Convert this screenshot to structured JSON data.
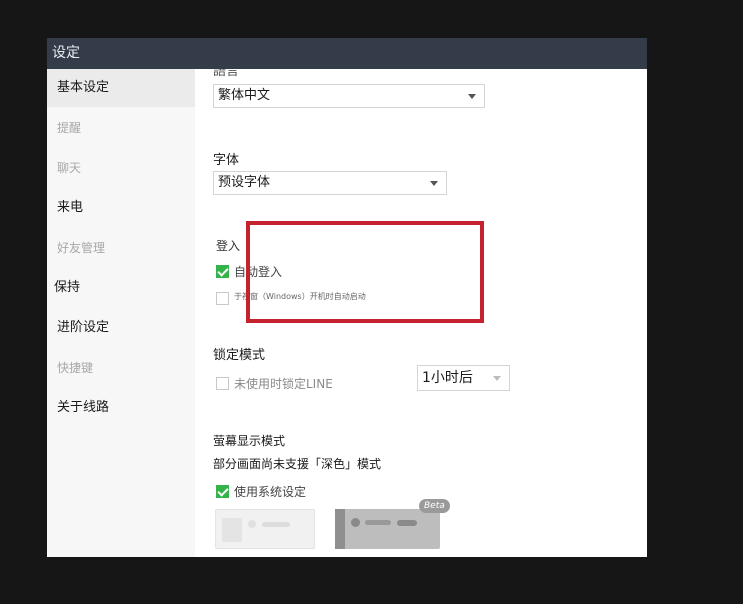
{
  "window": {
    "title": "设定"
  },
  "sidebar": {
    "items": [
      {
        "label": "基本设定"
      },
      {
        "label": "提醒"
      },
      {
        "label": "聊天"
      },
      {
        "label": "来电"
      },
      {
        "label": "好友管理"
      },
      {
        "label": "保持"
      },
      {
        "label": "进阶设定"
      },
      {
        "label": "快捷键"
      },
      {
        "label": "关于线路"
      }
    ]
  },
  "language": {
    "label": "語言",
    "value": "繁体中文"
  },
  "font": {
    "label": "字体",
    "value": "预设字体"
  },
  "login": {
    "title": "登入",
    "auto_login": {
      "label": "自动登入",
      "checked": true
    },
    "startup": {
      "label": "于视窗（Windows）开机时自动启动",
      "checked": false
    }
  },
  "lock": {
    "title": "锁定模式",
    "checkbox_label": "未使用时锁定LINE",
    "checked": false,
    "duration": "1小时后"
  },
  "display": {
    "title": "萤幕显示模式",
    "subtitle": "部分画面尚未支援「深色」模式",
    "system_label": "使用系统设定",
    "system_checked": true,
    "beta_badge": "Beta"
  },
  "colors": {
    "accent": "#34b34a",
    "highlight": "#c4232d",
    "titlebar": "#343c4a"
  }
}
